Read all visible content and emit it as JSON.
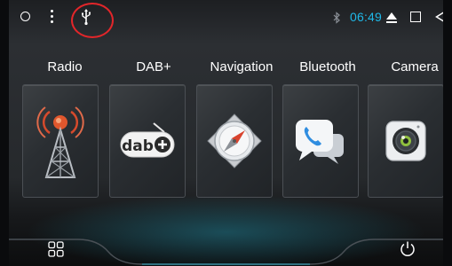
{
  "status_bar": {
    "clock": "06:49",
    "icons": [
      "circle-icon",
      "menu-dots-icon",
      "usb-icon",
      "bluetooth-icon",
      "eject-icon",
      "square-icon",
      "back-triangle-icon"
    ],
    "clock_color": "#1fb8e8",
    "annotation_color": "#e2262a"
  },
  "apps": [
    {
      "label": "Radio",
      "icon": "radio-tower-icon"
    },
    {
      "label": "DAB+",
      "icon": "dab-plus-icon"
    },
    {
      "label": "Navigation",
      "icon": "compass-icon"
    },
    {
      "label": "Bluetooth",
      "icon": "bluetooth-phone-icon"
    },
    {
      "label": "Camera",
      "icon": "camera-icon"
    }
  ],
  "bottom_bar": {
    "icons": [
      "apps-grid-icon",
      "power-icon"
    ]
  },
  "colors": {
    "accent_glow": "#28b4d2",
    "tile_border": "#4b4f54"
  }
}
